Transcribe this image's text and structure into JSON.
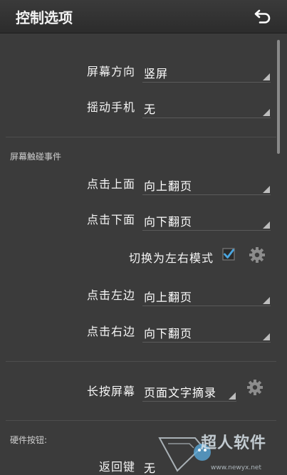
{
  "title": "控制选项",
  "icons": {
    "back": "back-arrow-icon",
    "gear": "gear-icon",
    "check": "checkbox-checked-icon",
    "dropdown": "dropdown-triangle-icon"
  },
  "colors": {
    "background": "#3b3b3b",
    "checkbox": "#4aa6e0",
    "text": "#ffffff"
  },
  "screen_direction": {
    "label": "屏幕方向",
    "value": "竖屏"
  },
  "shake_phone": {
    "label": "摇动手机",
    "value": "无"
  },
  "touch_section": {
    "header": "屏幕触碰事件"
  },
  "tap_top": {
    "label": "点击上面",
    "value": "向上翻页"
  },
  "tap_bottom": {
    "label": "点击下面",
    "value": "向下翻页"
  },
  "lr_mode": {
    "label": "切换为左右模式",
    "checked": true
  },
  "tap_left": {
    "label": "点击左边",
    "value": "向上翻页"
  },
  "tap_right": {
    "label": "点击右边",
    "value": "向下翻页"
  },
  "long_press": {
    "label": "长按屏幕",
    "value": "页面文字摘录"
  },
  "hardware_section": {
    "header": "硬件按钮:"
  },
  "back_key": {
    "label": "返回键",
    "value": "无"
  },
  "watermark": {
    "text": "超人软件",
    "url": "www.newyx.net"
  }
}
